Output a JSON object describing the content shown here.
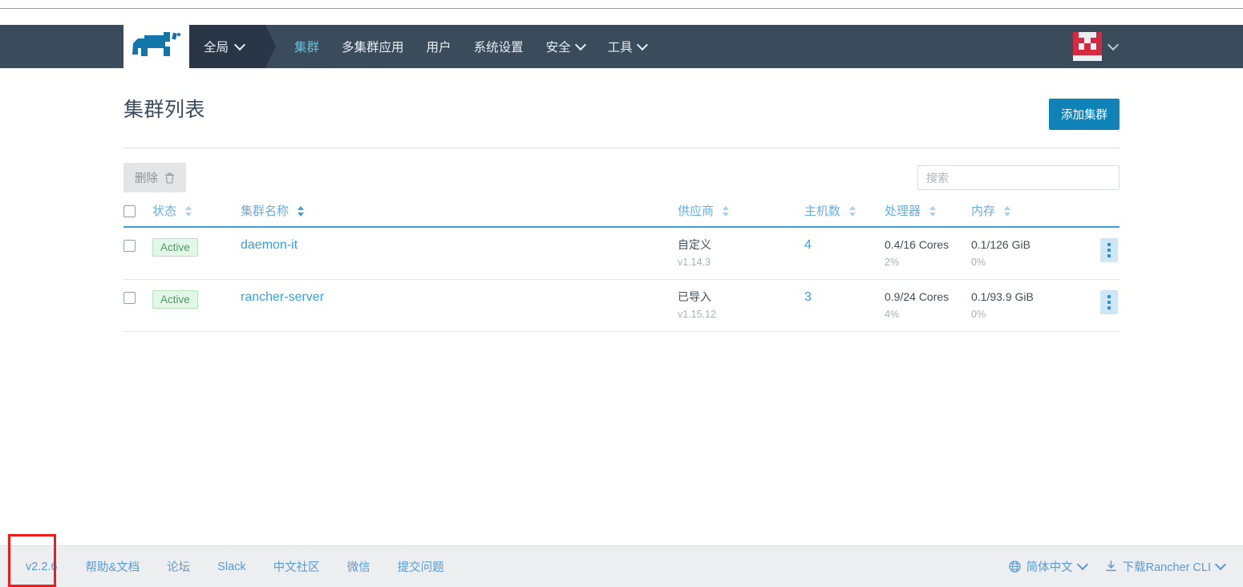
{
  "navbar": {
    "logo_name": "rancher-logo",
    "scope": {
      "label": "全局",
      "icon": "chevron-down-icon"
    },
    "links": [
      {
        "label": "集群",
        "active": true,
        "has_caret": false
      },
      {
        "label": "多集群应用",
        "active": false,
        "has_caret": false
      },
      {
        "label": "用户",
        "active": false,
        "has_caret": false
      },
      {
        "label": "系统设置",
        "active": false,
        "has_caret": false
      },
      {
        "label": "安全",
        "active": false,
        "has_caret": true
      },
      {
        "label": "工具",
        "active": false,
        "has_caret": true
      }
    ],
    "user": {
      "avatar_name": "user-avatar-identicon",
      "caret": "chevron-down-icon"
    },
    "colors": {
      "bar": "#3a4b5c",
      "scope_bg": "#2a3647",
      "active_link": "#63c0d8"
    }
  },
  "page": {
    "title": "集群列表",
    "add_button": "添加集群"
  },
  "toolbar": {
    "bulk_delete": "删除",
    "bulk_delete_icon": "trash-icon",
    "search_placeholder": "搜索",
    "search_value": ""
  },
  "table": {
    "headers": [
      {
        "key": "checkbox",
        "label": "",
        "sortable": false
      },
      {
        "key": "state",
        "label": "状态",
        "sortable": true,
        "sort_active": false
      },
      {
        "key": "name",
        "label": "集群名称",
        "sortable": true,
        "sort_active": true
      },
      {
        "key": "provider",
        "label": "供应商",
        "sortable": true,
        "sort_active": false
      },
      {
        "key": "hosts",
        "label": "主机数",
        "sortable": true,
        "sort_active": false
      },
      {
        "key": "cpu",
        "label": "处理器",
        "sortable": true,
        "sort_active": false
      },
      {
        "key": "memory",
        "label": "内存",
        "sortable": true,
        "sort_active": false
      },
      {
        "key": "actions",
        "label": "",
        "sortable": false
      }
    ],
    "rows": [
      {
        "selected": false,
        "state": "Active",
        "name": "daemon-it",
        "provider": "自定义",
        "provider_version": "v1.14.3",
        "hosts": "4",
        "cpu": "0.4/16 Cores",
        "cpu_pct": "2%",
        "memory": "0.1/126 GiB",
        "memory_pct": "0%",
        "actions_icon": "kebab-menu-icon"
      },
      {
        "selected": false,
        "state": "Active",
        "name": "rancher-server",
        "provider": "已导入",
        "provider_version": "v1.15.12",
        "hosts": "3",
        "cpu": "0.9/24 Cores",
        "cpu_pct": "4%",
        "memory": "0.1/93.9 GiB",
        "memory_pct": "0%",
        "actions_icon": "kebab-menu-icon"
      }
    ]
  },
  "footer": {
    "version": "v2.2.6",
    "links": [
      "帮助&文档",
      "论坛",
      "Slack",
      "中文社区",
      "微信",
      "提交问题"
    ],
    "language": {
      "label": "简体中文",
      "icon": "globe-icon",
      "caret": "chevron-down-icon"
    },
    "cli": {
      "label": "下载Rancher CLI",
      "icon": "download-icon",
      "caret": "chevron-down-icon"
    }
  },
  "annotation": {
    "color": "#ee1c1c",
    "target": "v2.2.6"
  }
}
